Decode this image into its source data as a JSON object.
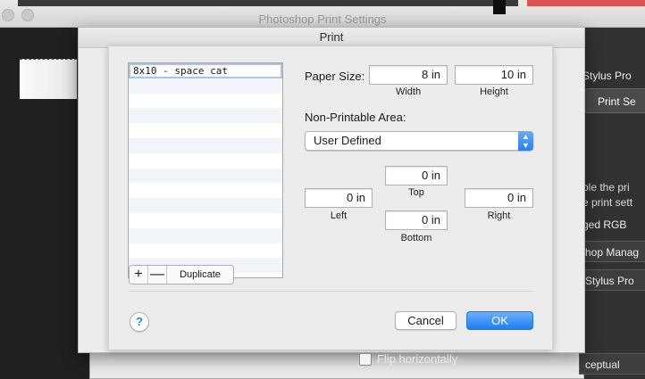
{
  "background": {
    "window_title": "Photoshop Print Settings",
    "right_panel": {
      "printer_name": "Stylus Pro",
      "print_settings_button": "Print Se",
      "description_line1": "ble the pri",
      "description_line2": "e print sett",
      "color_space": "ged RGB",
      "color_handling": "hop Manag",
      "printer_profile": "Stylus Pro",
      "rendering_intent": "ceptual"
    },
    "flip_horizontally_label": "Flip horizontally"
  },
  "print_dialog": {
    "title": "Print",
    "paper_sizes": {
      "items": [
        "8x10 - space cat"
      ],
      "selected_index": 0,
      "add_label": "+",
      "remove_label": "—",
      "duplicate_label": "Duplicate"
    },
    "paper_size": {
      "label": "Paper Size:",
      "width_value": "8 in",
      "width_label": "Width",
      "height_value": "10 in",
      "height_label": "Height"
    },
    "non_printable_area": {
      "label": "Non-Printable Area:",
      "selected_option": "User Defined"
    },
    "margins": {
      "top_value": "0 in",
      "top_label": "Top",
      "left_value": "0 in",
      "left_label": "Left",
      "right_value": "0 in",
      "right_label": "Right",
      "bottom_value": "0 in",
      "bottom_label": "Bottom"
    },
    "help_label": "?",
    "cancel_label": "Cancel",
    "ok_label": "OK",
    "colors": {
      "accent": "#2a7ff0",
      "selection_outline": "#a9c3e9"
    }
  }
}
